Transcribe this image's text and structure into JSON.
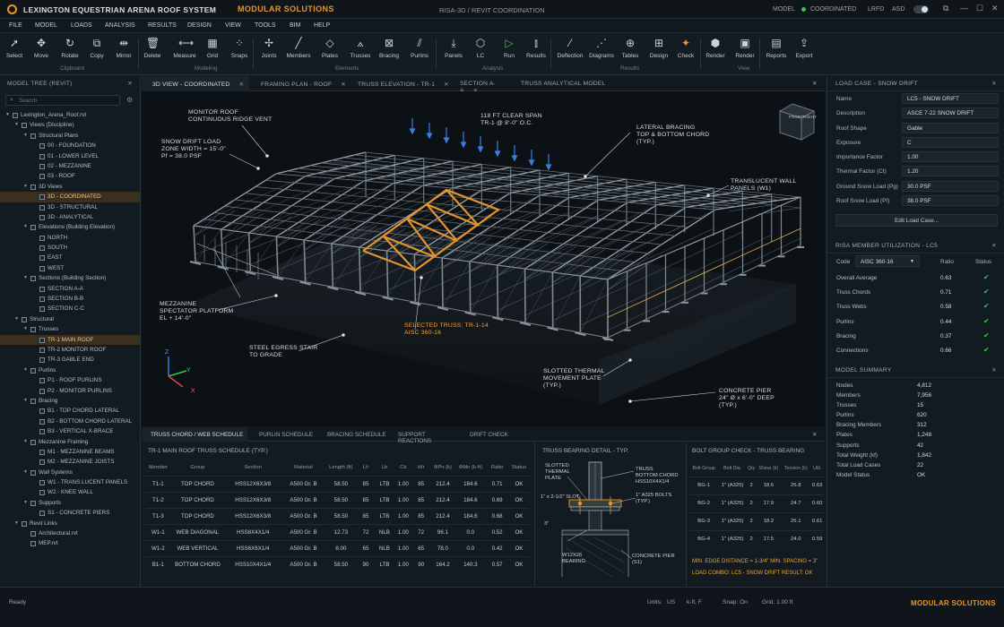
{
  "app": {
    "title": "LEXINGTON EQUESTRIAN ARENA ROOF SYSTEM",
    "tag": "MODULAR SOLUTIONS",
    "document": "RISA-3D / REVIT COORDINATION",
    "model_label": "MODEL",
    "coord_label": "COORDINATED",
    "lrfd": "LRFD",
    "asd": "ASD",
    "accent": "#e6962c",
    "status_green": "#43c24b"
  },
  "menu": [
    "FILE",
    "MODEL",
    "LOADS",
    "ANALYSIS",
    "RESULTS",
    "DESIGN",
    "VIEW",
    "TOOLS",
    "BIM",
    "HELP"
  ],
  "ribbon": {
    "tools": [
      {
        "label": "Select",
        "icon": "cursor-icon"
      },
      {
        "label": "Move",
        "icon": "move-icon"
      },
      {
        "label": "Rotate",
        "icon": "rotate-icon"
      },
      {
        "label": "Copy",
        "icon": "copy-icon"
      },
      {
        "label": "Mirror",
        "icon": "mirror-icon"
      },
      {
        "label": "Delete",
        "icon": "trash-icon"
      },
      {
        "label": "Measure",
        "icon": "ruler-icon"
      },
      {
        "label": "Grid",
        "icon": "grid-icon"
      },
      {
        "label": "Snaps",
        "icon": "snap-icon"
      },
      {
        "label": "Joints",
        "icon": "joint-icon"
      },
      {
        "label": "Members",
        "icon": "member-icon"
      },
      {
        "label": "Plates",
        "icon": "plate-icon"
      },
      {
        "label": "Trusses",
        "icon": "truss-icon"
      },
      {
        "label": "Bracing",
        "icon": "bracing-icon"
      },
      {
        "label": "Purlins",
        "icon": "purlin-icon"
      },
      {
        "label": "Panels",
        "icon": "panel-icon"
      },
      {
        "label": "LC",
        "icon": "load-case-icon"
      },
      {
        "label": "Run",
        "icon": "play-icon"
      },
      {
        "label": "Results",
        "icon": "results-icon"
      },
      {
        "label": "Deflection",
        "icon": "deflection-icon"
      },
      {
        "label": "Diagrams",
        "icon": "diagram-icon"
      },
      {
        "label": "Tables",
        "icon": "table-icon"
      },
      {
        "label": "Design",
        "icon": "design-icon"
      },
      {
        "label": "Check",
        "icon": "check-icon"
      },
      {
        "label": "Render",
        "icon": "cube-icon"
      },
      {
        "label": "Render",
        "icon": "render-icon"
      },
      {
        "label": "Reports",
        "icon": "report-icon"
      },
      {
        "label": "Export",
        "icon": "export-icon"
      }
    ],
    "groups": [
      "Clipboard",
      "Modeling",
      "Elements",
      "Analysis",
      "Results",
      "View"
    ]
  },
  "tree": {
    "title": "MODEL TREE (REVIT)",
    "search_placeholder": "Search",
    "items": [
      {
        "label": "Lexington_Arena_Roof.rvt",
        "depth": 0,
        "exp": "v"
      },
      {
        "label": "Views (Discipline)",
        "depth": 1,
        "exp": "v"
      },
      {
        "label": "Structural Plans",
        "depth": 2,
        "exp": "v"
      },
      {
        "label": "00 - FOUNDATION",
        "depth": 3
      },
      {
        "label": "01 - LOWER LEVEL",
        "depth": 3
      },
      {
        "label": "02 - MEZZANINE",
        "depth": 3
      },
      {
        "label": "03 - ROOF",
        "depth": 3
      },
      {
        "label": "3D Views",
        "depth": 2,
        "exp": "v"
      },
      {
        "label": "3D - COORDINATED",
        "depth": 3,
        "sel": true
      },
      {
        "label": "3D - STRUCTURAL",
        "depth": 3
      },
      {
        "label": "3D - ANALYTICAL",
        "depth": 3
      },
      {
        "label": "Elevations (Building Elevation)",
        "depth": 2,
        "exp": "v"
      },
      {
        "label": "NORTH",
        "depth": 3
      },
      {
        "label": "SOUTH",
        "depth": 3
      },
      {
        "label": "EAST",
        "depth": 3
      },
      {
        "label": "WEST",
        "depth": 3
      },
      {
        "label": "Sections (Building Section)",
        "depth": 2,
        "exp": "v"
      },
      {
        "label": "SECTION A-A",
        "depth": 3
      },
      {
        "label": "SECTION B-B",
        "depth": 3
      },
      {
        "label": "SECTION C-C",
        "depth": 3
      },
      {
        "label": "Structural",
        "depth": 1,
        "exp": "v"
      },
      {
        "label": "Trusses",
        "depth": 2,
        "exp": "v"
      },
      {
        "label": "TR-1 MAIN ROOF",
        "depth": 3,
        "sel": true
      },
      {
        "label": "TR-2 MONITOR ROOF",
        "depth": 3
      },
      {
        "label": "TR-3 GABLE END",
        "depth": 3
      },
      {
        "label": "Purlins",
        "depth": 2,
        "exp": "v"
      },
      {
        "label": "P1 - ROOF PURLINS",
        "depth": 3
      },
      {
        "label": "P2 - MONITOR PURLINS",
        "depth": 3
      },
      {
        "label": "Bracing",
        "depth": 2,
        "exp": "v"
      },
      {
        "label": "B1 - TOP CHORD LATERAL",
        "depth": 3
      },
      {
        "label": "B2 - BOTTOM CHORD LATERAL",
        "depth": 3
      },
      {
        "label": "B3 - VERTICAL X-BRACE",
        "depth": 3
      },
      {
        "label": "Mezzanine Framing",
        "depth": 2,
        "exp": "v"
      },
      {
        "label": "M1 - MEZZANINE BEAMS",
        "depth": 3
      },
      {
        "label": "M2 - MEZZANINE JOISTS",
        "depth": 3
      },
      {
        "label": "Wall Systems",
        "depth": 2,
        "exp": "v"
      },
      {
        "label": "W1 - TRANS LUCENT PANELS",
        "depth": 3
      },
      {
        "label": "W2 - KNEE WALL",
        "depth": 3
      },
      {
        "label": "Supports",
        "depth": 2,
        "exp": "v"
      },
      {
        "label": "S1 - CONCRETE PIERS",
        "depth": 3
      },
      {
        "label": "Revit Links",
        "depth": 1,
        "exp": "v"
      },
      {
        "label": "Architectural.rvt",
        "depth": 2
      },
      {
        "label": "MEP.rvt",
        "depth": 2
      }
    ]
  },
  "view_tabs": [
    "3D VIEW - COORDINATED",
    "FRAMING PLAN - ROOF",
    "TRUSS ELEVATION - TR-1",
    "SECTION A-A",
    "TRUSS ANALYTICAL MODEL"
  ],
  "viewport": {
    "viewcube": {
      "front": "FRONT",
      "right": "RIGHT"
    },
    "axes": {
      "x": "X",
      "y": "Y",
      "z": "Z"
    },
    "callouts": [
      {
        "text": "MONITOR ROOF\nCONTINUOUS RIDGE VENT"
      },
      {
        "text": "118 FT CLEAR SPAN\nTR-1 @ 8'-0\" O.C."
      },
      {
        "text": "SNOW DRIFT LOAD\nZONE WIDTH = 15'-0\"\nPf = 38.0 PSF"
      },
      {
        "text": "LATERAL BRACING\nTOP & BOTTOM CHORD\n(TYP.)"
      },
      {
        "text": "TRANSLUCENT WALL\nPANELS (W1)"
      },
      {
        "text": "MEZZANINE\nSPECTATOR PLATFORM\nEL + 14'-0\""
      },
      {
        "text": "SELECTED TRUSS: TR-1-14\nAISC 360-16"
      },
      {
        "text": "STEEL EGRESS STAIR\nTO GRADE"
      },
      {
        "text": "SLOTTED THERMAL\nMOVEMENT PLATE\n(TYP.)"
      },
      {
        "text": "CONCRETE PIER\n24\" Ø x 6'-0\" DEEP\n(TYP.)"
      }
    ]
  },
  "bottom_tabs": [
    "TRUSS CHORD / WEB SCHEDULE",
    "PURLIN SCHEDULE",
    "BRACING SCHEDULE",
    "SUPPORT REACTIONS",
    "DRIFT CHECK"
  ],
  "schedule": {
    "title": "TR-1 MAIN ROOF TRUSS SCHEDULE (TYP.)",
    "columns": [
      "Member",
      "Group",
      "Section",
      "Material",
      "Length (ft)",
      "L/r",
      "Lb",
      "Cb",
      "kl/r",
      "ΦPn (k)",
      "ΦMn (k-ft)",
      "Ratio",
      "Status"
    ],
    "rows": [
      [
        "T1-1",
        "TOP CHORD",
        "HSS12X6X3/8",
        "A500 Gr. B",
        "58.50",
        "85",
        "LTB",
        "1.00",
        "85",
        "212.4",
        "184.6",
        "0.71",
        "OK"
      ],
      [
        "T1-2",
        "TOP CHORD",
        "HSS12X6X3/8",
        "A500 Gr. B",
        "58.50",
        "85",
        "LTB",
        "1.00",
        "85",
        "212.4",
        "184.6",
        "0.69",
        "OK"
      ],
      [
        "T1-3",
        "TOP CHORD",
        "HSS12X6X3/8",
        "A500 Gr. B",
        "58.50",
        "85",
        "LTB",
        "1.00",
        "85",
        "212.4",
        "184.6",
        "0.68",
        "OK"
      ],
      [
        "W1-1",
        "WEB DIAGONAL",
        "HSS8X4X1/4",
        "A500 Gr. B",
        "12.73",
        "72",
        "NLB",
        "1.00",
        "72",
        "96.1",
        "0.0",
        "0.52",
        "OK"
      ],
      [
        "W1-2",
        "WEB VERTICAL",
        "HSS6X6X1/4",
        "A500 Gr. B",
        "8.00",
        "65",
        "NLB",
        "1.00",
        "65",
        "78.0",
        "0.0",
        "0.42",
        "OK"
      ],
      [
        "B1-1",
        "BOTTOM CHORD",
        "HSS10X4X1/4",
        "A500 Gr. B",
        "58.50",
        "90",
        "LTB",
        "1.00",
        "90",
        "164.2",
        "140.3",
        "0.57",
        "OK"
      ]
    ]
  },
  "bearing": {
    "title": "TRUSS BEARING DETAIL - TYP.",
    "labels": [
      "SLOTTED\nTHERMAL\nPLATE",
      "TRUSS\nBOTTOM CHORD\nHSS10X4X1/4",
      "1\" x 2-1/2\" SLOT",
      "1\" A325 BOLTS\n(TYP.)",
      "3\"",
      "W12X26\nBEARING",
      "CONCRETE PIER\n(S1)"
    ]
  },
  "bolts": {
    "title": "BOLT GROUP CHECK - TRUSS BEARING",
    "columns": [
      "Bolt Group",
      "Bolt Dia.",
      "Qty",
      "Shear (k)",
      "Tension (k)",
      "Util."
    ],
    "rows": [
      [
        "BG-1",
        "1\" (A325)",
        "2",
        "18.6",
        "25.8",
        "0.63"
      ],
      [
        "BG-2",
        "1\" (A325)",
        "2",
        "17.9",
        "24.7",
        "0.60"
      ],
      [
        "BG-3",
        "1\" (A325)",
        "2",
        "18.2",
        "25.1",
        "0.61"
      ],
      [
        "BG-4",
        "1\" (A325)",
        "2",
        "17.5",
        "24.0",
        "0.59"
      ]
    ],
    "note1": "MIN. EDGE DISTANCE = 1-3/4\"   MIN. SPACING = 3\"",
    "note2": "LOAD COMBO: LC5 - SNOW DRIFT     RESULT: OK"
  },
  "load_case": {
    "title": "LOAD CASE - SNOW DRIFT",
    "fields": [
      {
        "k": "Name",
        "v": "LC5 - SNOW DRIFT"
      },
      {
        "k": "Description",
        "v": "ASCE 7-22 SNOW DRIFT"
      },
      {
        "k": "Roof Shape",
        "v": "Gable"
      },
      {
        "k": "Exposure",
        "v": "C"
      },
      {
        "k": "Importance Factor",
        "v": "1.00"
      },
      {
        "k": "Thermal Factor (Ct)",
        "v": "1.20"
      },
      {
        "k": "Ground Snow Load (Pg)",
        "v": "30.0 PSF"
      },
      {
        "k": "Roof Snow Load (Pf)",
        "v": "38.0 PSF"
      }
    ],
    "edit_button": "Edit Load Case..."
  },
  "utilization": {
    "title": "RISA MEMBER UTILIZATION - LC5",
    "code_label": "Code",
    "code_value": "AISC 360-16",
    "ratio_label": "Ratio",
    "status_label": "Status",
    "rows": [
      {
        "k": "Overall Average",
        "r": "0.63"
      },
      {
        "k": "Truss Chords",
        "r": "0.71"
      },
      {
        "k": "Truss Webs",
        "r": "0.58"
      },
      {
        "k": "Purlins",
        "r": "0.44"
      },
      {
        "k": "Bracing",
        "r": "0.37"
      },
      {
        "k": "Connections",
        "r": "0.66"
      }
    ]
  },
  "summary": {
    "title": "MODEL SUMMARY",
    "rows": [
      {
        "k": "Nodes",
        "v": "4,812"
      },
      {
        "k": "Members",
        "v": "7,956"
      },
      {
        "k": "Trusses",
        "v": "15"
      },
      {
        "k": "Purlins",
        "v": "620"
      },
      {
        "k": "Bracing Members",
        "v": "312"
      },
      {
        "k": "Plates",
        "v": "1,248"
      },
      {
        "k": "Supports",
        "v": "42"
      },
      {
        "k": "Total Weight (kf)",
        "v": "1,842"
      },
      {
        "k": "Total Load Cases",
        "v": "22"
      },
      {
        "k": "Model Status",
        "v": "OK"
      }
    ]
  },
  "statusbar": {
    "ready": "Ready",
    "units_label": "Units:",
    "units": "US",
    "units2": "k-ft, F",
    "snap": "Snap: On",
    "grid": "Grid: 1.00 ft",
    "brand": "MODULAR SOLUTIONS"
  }
}
